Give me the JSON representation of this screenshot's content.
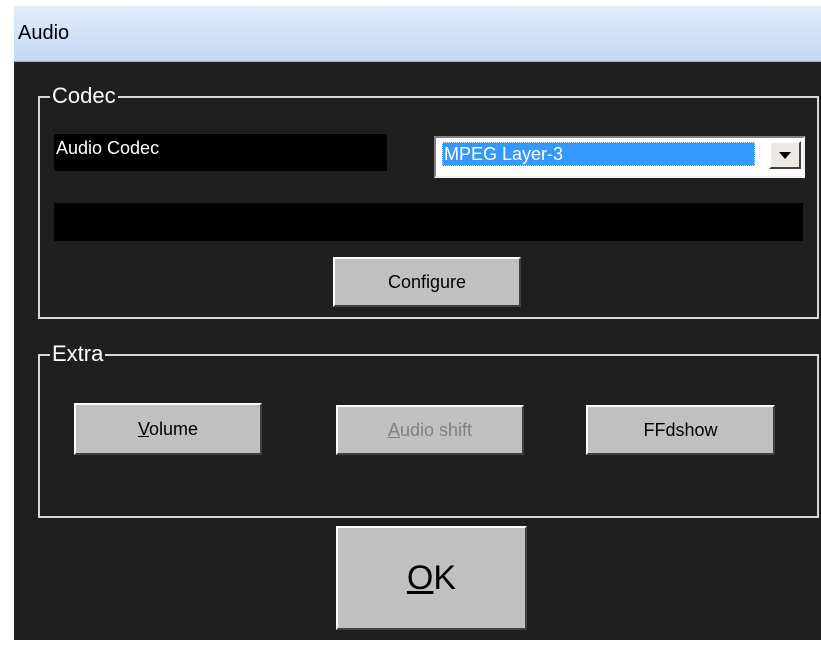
{
  "window": {
    "title": "Audio"
  },
  "codec": {
    "group_label": "Codec",
    "audio_codec_label": "Audio Codec",
    "selected_codec": "MPEG Layer-3",
    "info_text": "",
    "configure_label": "Configure"
  },
  "extra": {
    "group_label": "Extra",
    "volume": {
      "mnemonic": "V",
      "rest": "olume"
    },
    "audio_shift": {
      "mnemonic": "A",
      "rest": "udio shift",
      "enabled": false
    },
    "ffdshow_label": "FFdshow"
  },
  "ok": {
    "mnemonic": "O",
    "rest": "K"
  },
  "colors": {
    "background": "#1f1f1f",
    "button_face": "#c0c0c0",
    "selection": "#3399ff",
    "titlebar": "#cfe1f6"
  }
}
